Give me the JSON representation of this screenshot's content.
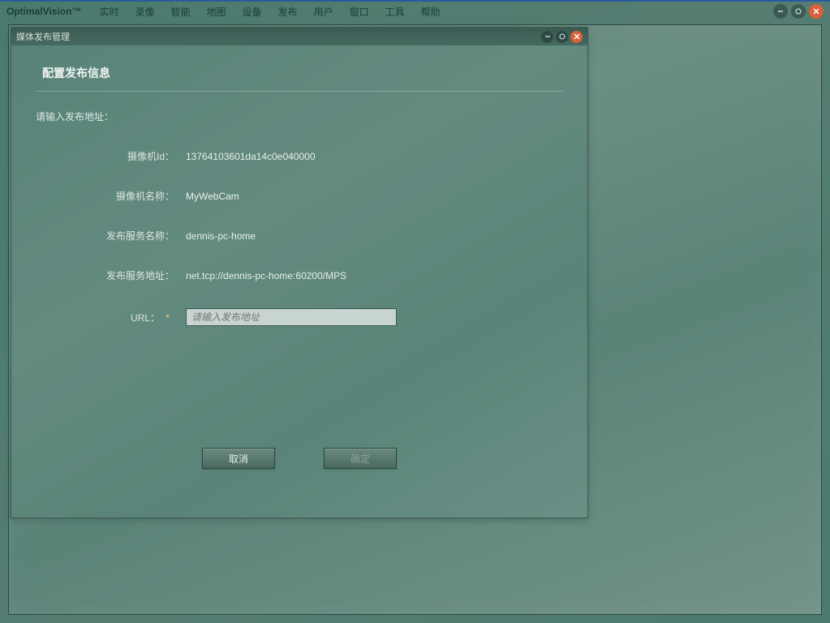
{
  "app": {
    "title": "OptimalVision™"
  },
  "menu": {
    "items": [
      "实时",
      "录像",
      "智能",
      "地图",
      "设备",
      "发布",
      "用户",
      "窗口",
      "工具",
      "帮助"
    ]
  },
  "dialog": {
    "title": "媒体发布管理",
    "header": "配置发布信息",
    "prompt": "请输入发布地址：",
    "fields": {
      "camera_id": {
        "label": "摄像机Id：",
        "value": "13764103601da14c0e040000"
      },
      "camera_name": {
        "label": "摄像机名称：",
        "value": "MyWebCam"
      },
      "service_name": {
        "label": "发布服务名称：",
        "value": "dennis-pc-home"
      },
      "service_addr": {
        "label": "发布服务地址：",
        "value": "net.tcp://dennis-pc-home:60200/MPS"
      },
      "url": {
        "label": "URL：",
        "required": "*",
        "placeholder": "请输入发布地址",
        "value": ""
      }
    },
    "buttons": {
      "cancel": "取消",
      "ok": "确定"
    }
  }
}
